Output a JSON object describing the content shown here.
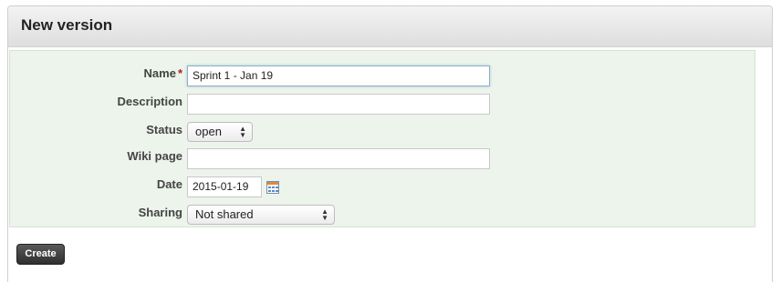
{
  "header": {
    "title": "New version"
  },
  "form": {
    "name": {
      "label": "Name",
      "required_mark": "*",
      "value": "Sprint 1 - Jan 19"
    },
    "description": {
      "label": "Description",
      "value": ""
    },
    "status": {
      "label": "Status",
      "value": "open"
    },
    "wiki_page": {
      "label": "Wiki page",
      "value": ""
    },
    "date": {
      "label": "Date",
      "value": "2015-01-19",
      "picker_icon": "calendar-icon"
    },
    "sharing": {
      "label": "Sharing",
      "value": "Not shared"
    }
  },
  "actions": {
    "create_label": "Create"
  },
  "colors": {
    "form_background": "#edf4ec",
    "required": "#b22222",
    "button": "#3a3a3a"
  }
}
